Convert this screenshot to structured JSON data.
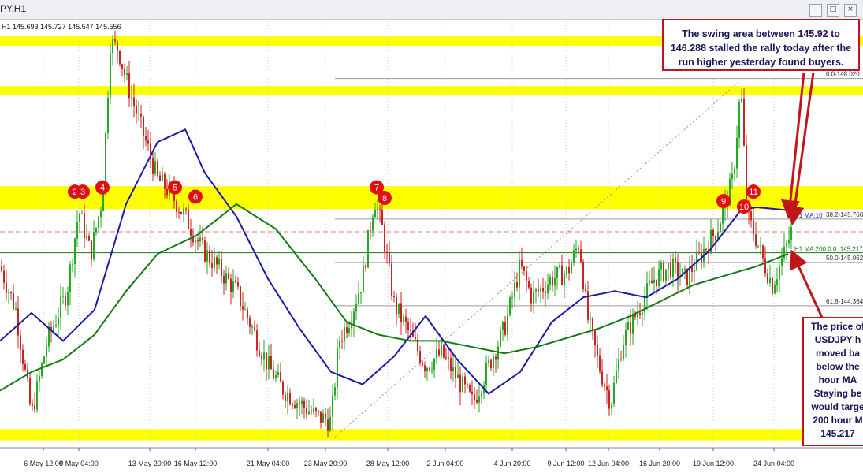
{
  "window": {
    "title": "PY,H1",
    "ohlc_text": "H1  145.693 145.727 145.547 145.556",
    "controls": [
      "–",
      "□",
      "×"
    ]
  },
  "colors": {
    "zone": "#ffff00",
    "candle_up": "#22aa22",
    "candle_down": "#cc2222",
    "ma100": "#1a1aa8",
    "ma200": "#137a13",
    "marker": "#e01010",
    "callout_border": "#c0151a",
    "callout_text": "#15155a",
    "fib_line": "#9a9a9a",
    "price_dash": "#e08080"
  },
  "annotations": {
    "swing_callout": "The swing area between 145.92 to 146.288 stalled the rally today after the run higher yesterday found buyers.",
    "price_callout_lines": [
      "The price of",
      "USDJPY h",
      "moved ba",
      "below the",
      "hour MA",
      "Staying be",
      "would targe",
      "200 hour M",
      "145.217"
    ]
  },
  "chart_data": {
    "type": "candlestick",
    "instrument": "USDJPY",
    "timeframe": "H1",
    "x_tick_labels": [
      "6 May 12:00",
      "9 May 04:00",
      "13 May 20:00",
      "16 May 12:00",
      "21 May 04:00",
      "23 May 20:00",
      "28 May 12:00",
      "2 Jun 04:00",
      "4 Jun 20:00",
      "9 Jun 12:00",
      "12 Jun 04:00",
      "16 Jun 20:00",
      "19 Jun 12:00",
      "24 Jun 04:00"
    ],
    "fib_levels": [
      {
        "label": "0.0-148.020",
        "value": 148.02
      },
      {
        "label": "38.2-145.760",
        "value": 145.76
      },
      {
        "label": "50.0-145.062",
        "value": 145.062
      },
      {
        "label": "61.8-144.364",
        "value": 144.364
      }
    ],
    "ma_labels": [
      {
        "label": "H1 MA:10",
        "value": 145.76
      },
      {
        "label": "H1 MA:200:0:0: 145.217",
        "value": 145.217
      }
    ],
    "resistance_zones": [
      {
        "low": 148.55,
        "high": 148.7
      },
      {
        "low": 147.76,
        "high": 147.9
      },
      {
        "low": 145.92,
        "high": 146.288
      }
    ],
    "support_zones": [
      {
        "low": 142.2,
        "high": 142.38
      }
    ],
    "markers": [
      {
        "label": "2",
        "t": 95,
        "p": 146.2
      },
      {
        "label": "3",
        "t": 105,
        "p": 146.2
      },
      {
        "label": "4",
        "t": 130,
        "p": 146.27
      },
      {
        "label": "5",
        "t": 222,
        "p": 146.27
      },
      {
        "label": "6",
        "t": 248,
        "p": 146.12
      },
      {
        "label": "7",
        "t": 478,
        "p": 146.27
      },
      {
        "label": "8",
        "t": 488,
        "p": 146.1
      },
      {
        "label": "9",
        "t": 918,
        "p": 146.05
      },
      {
        "label": "10",
        "t": 944,
        "p": 145.96
      },
      {
        "label": "11",
        "t": 956,
        "p": 146.2
      }
    ],
    "close_path": [
      [
        0,
        145.0
      ],
      [
        20,
        144.3
      ],
      [
        40,
        142.6
      ],
      [
        60,
        143.8
      ],
      [
        85,
        144.6
      ],
      [
        100,
        145.9
      ],
      [
        115,
        145.2
      ],
      [
        130,
        146.1
      ],
      [
        140,
        148.6
      ],
      [
        150,
        148.5
      ],
      [
        160,
        148.0
      ],
      [
        180,
        147.2
      ],
      [
        200,
        146.4
      ],
      [
        215,
        146.2
      ],
      [
        235,
        145.8
      ],
      [
        255,
        145.3
      ],
      [
        275,
        145.0
      ],
      [
        300,
        144.6
      ],
      [
        320,
        144.0
      ],
      [
        340,
        143.4
      ],
      [
        360,
        143.0
      ],
      [
        380,
        142.8
      ],
      [
        400,
        142.6
      ],
      [
        420,
        142.5
      ],
      [
        430,
        143.8
      ],
      [
        445,
        144.2
      ],
      [
        460,
        144.8
      ],
      [
        475,
        146.1
      ],
      [
        485,
        145.6
      ],
      [
        500,
        144.4
      ],
      [
        520,
        143.9
      ],
      [
        540,
        143.4
      ],
      [
        560,
        143.6
      ],
      [
        580,
        143.2
      ],
      [
        600,
        142.8
      ],
      [
        620,
        143.4
      ],
      [
        640,
        144.0
      ],
      [
        660,
        145.0
      ],
      [
        675,
        144.5
      ],
      [
        700,
        144.8
      ],
      [
        720,
        144.9
      ],
      [
        735,
        145.4
      ],
      [
        745,
        144.2
      ],
      [
        760,
        143.4
      ],
      [
        775,
        142.8
      ],
      [
        790,
        143.8
      ],
      [
        810,
        144.3
      ],
      [
        830,
        144.8
      ],
      [
        850,
        145.0
      ],
      [
        870,
        144.8
      ],
      [
        890,
        145.2
      ],
      [
        910,
        145.6
      ],
      [
        930,
        146.4
      ],
      [
        940,
        147.9
      ],
      [
        948,
        145.8
      ],
      [
        958,
        145.5
      ],
      [
        968,
        145.1
      ],
      [
        980,
        144.7
      ],
      [
        995,
        145.2
      ],
      [
        1005,
        145.6
      ]
    ],
    "ma100_path": [
      [
        0,
        143.8
      ],
      [
        40,
        144.25
      ],
      [
        80,
        143.8
      ],
      [
        120,
        144.3
      ],
      [
        160,
        146.0
      ],
      [
        200,
        147.0
      ],
      [
        235,
        147.2
      ],
      [
        260,
        146.5
      ],
      [
        300,
        145.8
      ],
      [
        340,
        144.8
      ],
      [
        380,
        144.0
      ],
      [
        420,
        143.3
      ],
      [
        460,
        143.1
      ],
      [
        500,
        143.55
      ],
      [
        540,
        144.2
      ],
      [
        580,
        143.5
      ],
      [
        620,
        142.95
      ],
      [
        660,
        143.3
      ],
      [
        700,
        144.1
      ],
      [
        740,
        144.5
      ],
      [
        780,
        144.6
      ],
      [
        820,
        144.5
      ],
      [
        860,
        144.8
      ],
      [
        900,
        145.25
      ],
      [
        940,
        145.9
      ],
      [
        960,
        145.95
      ],
      [
        1000,
        145.9
      ]
    ],
    "ma200_path": [
      [
        0,
        143.0
      ],
      [
        40,
        143.3
      ],
      [
        80,
        143.5
      ],
      [
        120,
        143.9
      ],
      [
        160,
        144.6
      ],
      [
        200,
        145.2
      ],
      [
        250,
        145.5
      ],
      [
        300,
        146.0
      ],
      [
        350,
        145.6
      ],
      [
        400,
        144.8
      ],
      [
        440,
        144.1
      ],
      [
        480,
        143.9
      ],
      [
        520,
        143.8
      ],
      [
        560,
        143.8
      ],
      [
        600,
        143.7
      ],
      [
        640,
        143.6
      ],
      [
        680,
        143.7
      ],
      [
        720,
        143.85
      ],
      [
        760,
        144.0
      ],
      [
        800,
        144.2
      ],
      [
        840,
        144.45
      ],
      [
        880,
        144.7
      ],
      [
        920,
        144.85
      ],
      [
        960,
        145.0
      ],
      [
        1000,
        145.2
      ]
    ],
    "time_range": [
      0,
      1010
    ],
    "price_range": [
      142.08,
      148.98
    ]
  }
}
